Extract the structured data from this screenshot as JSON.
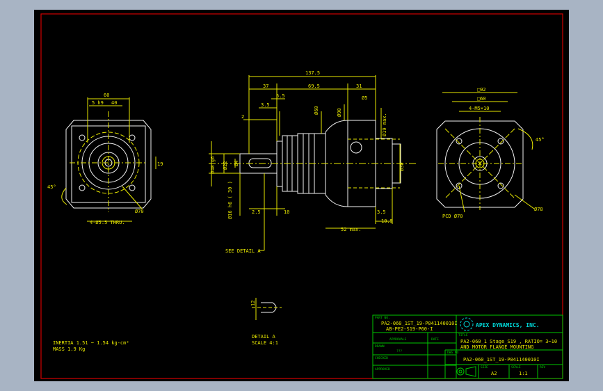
{
  "front_view": {
    "dims": {
      "width": "60",
      "key_width": "5 h9",
      "key_height": "40",
      "side": "19",
      "angle": "45°",
      "pcd": "Ø70",
      "holes": "4-Ø5.5 THRU."
    }
  },
  "side_view": {
    "dims": {
      "overall": "137.5",
      "d37": "37",
      "d69_5": "69.5",
      "d31": "31",
      "d5_5": "5.5",
      "d3_5": "3.5",
      "d2": "2",
      "d2_5": "2.5",
      "d10": "10",
      "d3_5b": "3.5",
      "d10_5": "10.5",
      "d52": "52 max.",
      "d25": "25",
      "d40": "40",
      "d60": "Ø60",
      "d90": "Ø90",
      "d05": "Ø5",
      "d19": "Ø19 max.",
      "d30": "Ø30",
      "shaft": "Ø16 h6",
      "shaft_len": "(30)",
      "d22": "Ø22",
      "d16": "Ø16 h6 ( 30 )",
      "d40b": "Ø40 g6",
      "d_small": "Ø4",
      "see_detail": "SEE DETAIL A"
    }
  },
  "motor_view": {
    "dims": {
      "sq92": "□92",
      "sq60": "□60",
      "tap": "4-M5×10",
      "angle": "45°",
      "d78": "Ø78",
      "pcd": "PCD Ø70"
    }
  },
  "detail": {
    "dim": "12",
    "label": "DETAIL A",
    "scale": "SCALE 4:1"
  },
  "notes": {
    "inertia": "INERTIA 1.51 ~ 1.54 kg-cm²",
    "mass": "MASS 1.9   Kg"
  },
  "title_block": {
    "part_no_label": "PART NO.",
    "part_no_line1": "PA2-060_1ST_19-P041140010I",
    "part_no_line2": "AB-PE2-S19-P60-I",
    "company": "APEX DYNAMICS, INC.",
    "approvals_label": "APPROVALS",
    "date_label": "DATE",
    "drawn_label": "DRAWN",
    "drawn_value": "???",
    "checked_label": "CHECKED",
    "approved_label": "APPROVED",
    "title_label": "TITLE",
    "title_line1": "PA2-060_1 Stage_S19 , RATIO= 3~10",
    "title_line2": "AND MOTOR FLANGE MOUNTING",
    "dwg_label": "DWG NO",
    "dwg_value": "PA2-060_1ST_19-P041140010I",
    "size_label": "SIZE",
    "size_value": "A2",
    "scale_label": "SCALE",
    "scale_value": "1:1",
    "rev_label": "REV"
  },
  "colors": {
    "frame": "#d00000",
    "geometry": "#e8e800",
    "outline": "#f2f2f2",
    "titleblock": "#00c800",
    "logo": "#00d8d8"
  }
}
